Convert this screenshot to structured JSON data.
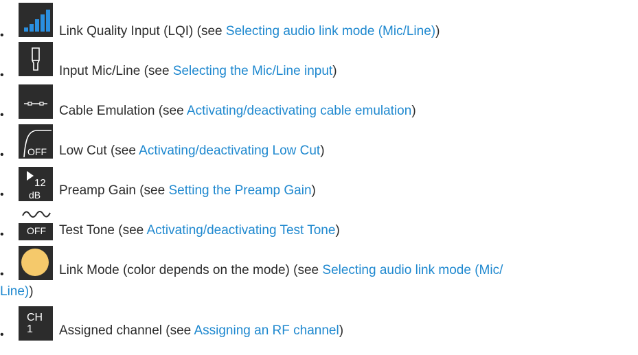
{
  "items": [
    {
      "text": "Link Quality Input (LQI) (see ",
      "link": "Selecting audio link mode (Mic/Line)",
      "close": ")"
    },
    {
      "text": "Input Mic/Line (see ",
      "link": "Selecting the Mic/Line input",
      "close": ")"
    },
    {
      "text": "Cable Emulation (see ",
      "link": "Activating/deactivating cable emulation",
      "close": ")"
    },
    {
      "text": "Low Cut (see ",
      "link": "Activating/deactivating Low Cut",
      "close": ")",
      "icon_label": "OFF"
    },
    {
      "text": "Preamp Gain (see ",
      "link": "Setting the Preamp Gain",
      "close": ")",
      "icon_value": "12",
      "icon_unit": "dB"
    },
    {
      "text": "Test Tone (see ",
      "link": "Activating/deactivating Test Tone",
      "close": ")",
      "icon_label": "OFF"
    },
    {
      "text": "Link Mode (color depends on the mode) (see ",
      "link_part1": "Selecting audio link mode (Mic/",
      "link_part2": "Line)",
      "close": ")",
      "mode_color": "#f5c96b"
    },
    {
      "text": "Assigned channel (see ",
      "link": "Assigning an RF channel",
      "close": ")",
      "icon_line1": "CH",
      "icon_line2": "1"
    }
  ],
  "colors": {
    "link": "#1e88cf",
    "icon_bg": "#2c2c2c",
    "lqi_bars": "#2a8fe0"
  },
  "icons": [
    "signal-bars-icon",
    "mic-line-input-icon",
    "cable-emulation-icon",
    "low-cut-icon",
    "preamp-gain-icon",
    "test-tone-icon",
    "link-mode-circle-icon",
    "channel-icon"
  ]
}
